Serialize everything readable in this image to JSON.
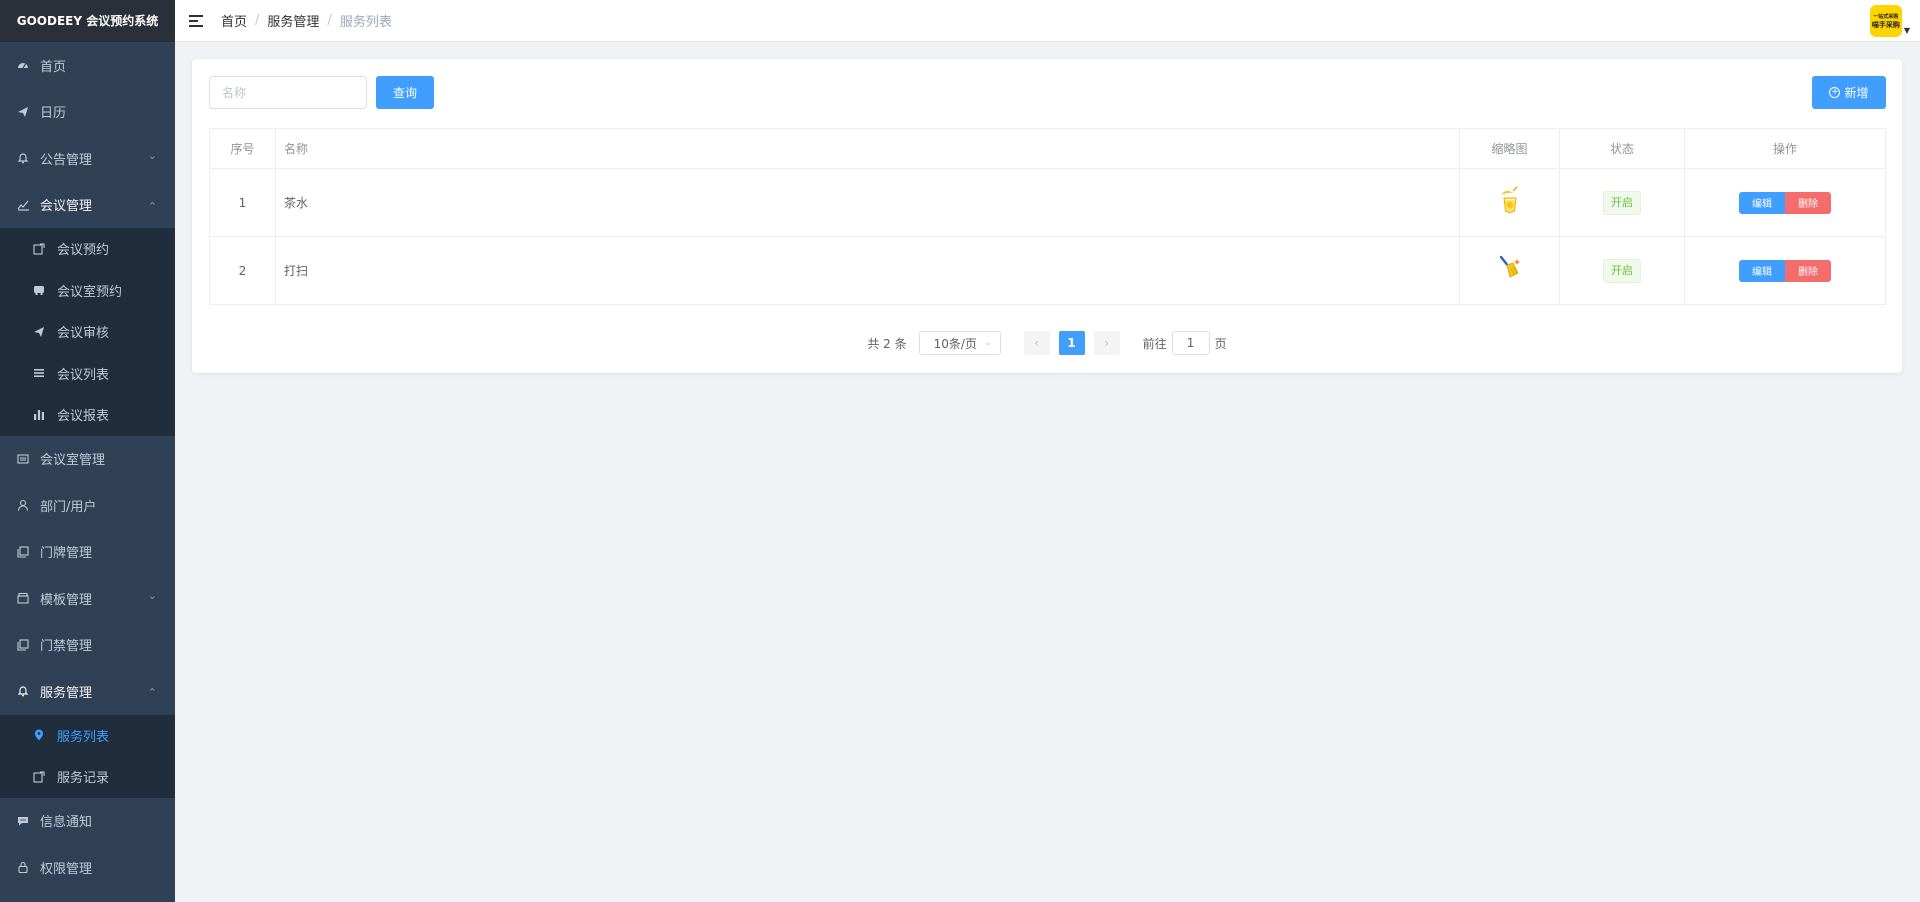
{
  "app": {
    "title": "GOODEEY 会议预约系统"
  },
  "sidebar": {
    "items": [
      {
        "label": "首页",
        "icon": "dashboard-icon",
        "arrow": ""
      },
      {
        "label": "日历",
        "icon": "paper-plane-icon",
        "arrow": ""
      },
      {
        "label": "公告管理",
        "icon": "bell-icon",
        "arrow": "⌄"
      },
      {
        "label": "会议管理",
        "icon": "chart-line-icon",
        "arrow": "⌃"
      },
      {
        "label": "会议室管理",
        "icon": "meeting-room-icon",
        "arrow": ""
      },
      {
        "label": "部门/用户",
        "icon": "user-icon",
        "arrow": ""
      },
      {
        "label": "门牌管理",
        "icon": "copy-icon",
        "arrow": ""
      },
      {
        "label": "模板管理",
        "icon": "box-icon",
        "arrow": "⌄"
      },
      {
        "label": "门禁管理",
        "icon": "copy-icon",
        "arrow": ""
      },
      {
        "label": "服务管理",
        "icon": "bell-icon",
        "arrow": "⌃"
      },
      {
        "label": "信息通知",
        "icon": "message-icon",
        "arrow": ""
      },
      {
        "label": "权限管理",
        "icon": "lock-icon",
        "arrow": ""
      }
    ],
    "meeting_sub": [
      {
        "label": "会议预约",
        "icon": "edit-icon"
      },
      {
        "label": "会议室预约",
        "icon": "bus-icon"
      },
      {
        "label": "会议审核",
        "icon": "paper-plane-icon"
      },
      {
        "label": "会议列表",
        "icon": "list-icon"
      },
      {
        "label": "会议报表",
        "icon": "bar-chart-icon"
      }
    ],
    "service_sub": [
      {
        "label": "服务列表",
        "icon": "location-icon"
      },
      {
        "label": "服务记录",
        "icon": "edit-icon"
      }
    ]
  },
  "header": {
    "breadcrumb": [
      "首页",
      "服务管理",
      "服务列表"
    ],
    "avatar_text_top": "一站式采购",
    "avatar_text_bottom": "喵手采购"
  },
  "toolbar": {
    "search_placeholder": "名称",
    "query_label": "查询",
    "add_label": "新增"
  },
  "table": {
    "headers": [
      "序号",
      "名称",
      "缩略图",
      "状态",
      "操作"
    ],
    "rows": [
      {
        "index": "1",
        "name": "茶水",
        "thumb": "drink-icon",
        "status": "开启",
        "edit": "编辑",
        "delete": "删除"
      },
      {
        "index": "2",
        "name": "打扫",
        "thumb": "broom-icon",
        "status": "开启",
        "edit": "编辑",
        "delete": "删除"
      }
    ]
  },
  "pagination": {
    "total_text": "共 2 条",
    "page_size": "10条/页",
    "current_page": "1",
    "goto_label": "前往",
    "goto_value": "1",
    "page_suffix": "页"
  },
  "colors": {
    "sidebar_bg": "#304156",
    "submenu_bg": "#1f2d3d",
    "primary": "#409eff",
    "danger": "#f56c6c",
    "success": "#67c23a"
  }
}
